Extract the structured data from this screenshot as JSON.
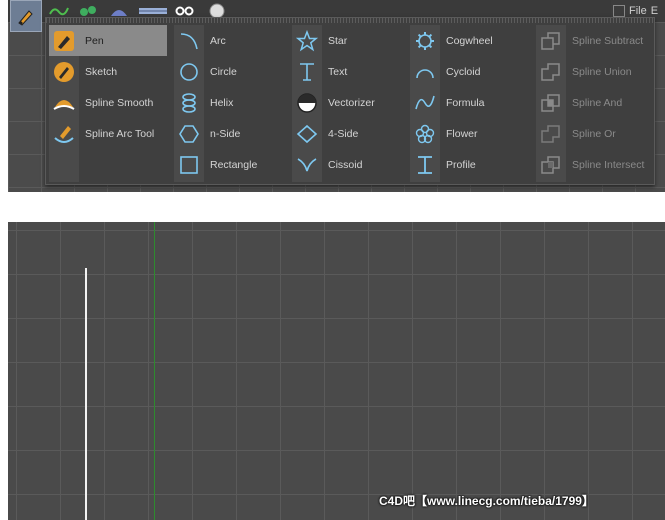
{
  "menubar": {
    "file_label": "File",
    "next_label": "E"
  },
  "menu": {
    "columns": [
      {
        "items": [
          {
            "label": "Pen",
            "icon": "pen-icon",
            "selected": true
          },
          {
            "label": "Sketch",
            "icon": "sketch-icon"
          },
          {
            "label": "Spline Smooth",
            "icon": "spline-smooth-icon"
          },
          {
            "label": "Spline Arc Tool",
            "icon": "spline-arc-tool-icon"
          }
        ]
      },
      {
        "items": [
          {
            "label": "Arc",
            "icon": "arc-icon"
          },
          {
            "label": "Circle",
            "icon": "circle-icon"
          },
          {
            "label": "Helix",
            "icon": "helix-icon"
          },
          {
            "label": "n-Side",
            "icon": "n-side-icon"
          },
          {
            "label": "Rectangle",
            "icon": "rectangle-icon"
          }
        ]
      },
      {
        "items": [
          {
            "label": "Star",
            "icon": "star-icon"
          },
          {
            "label": "Text",
            "icon": "text-icon"
          },
          {
            "label": "Vectorizer",
            "icon": "vectorizer-icon"
          },
          {
            "label": "4-Side",
            "icon": "four-side-icon"
          },
          {
            "label": "Cissoid",
            "icon": "cissoid-icon"
          }
        ]
      },
      {
        "items": [
          {
            "label": "Cogwheel",
            "icon": "cogwheel-icon"
          },
          {
            "label": "Cycloid",
            "icon": "cycloid-icon"
          },
          {
            "label": "Formula",
            "icon": "formula-icon"
          },
          {
            "label": "Flower",
            "icon": "flower-icon"
          },
          {
            "label": "Profile",
            "icon": "profile-icon"
          }
        ]
      },
      {
        "items": [
          {
            "label": "Spline Subtract",
            "icon": "spline-subtract-icon",
            "disabled": true
          },
          {
            "label": "Spline Union",
            "icon": "spline-union-icon",
            "disabled": true
          },
          {
            "label": "Spline And",
            "icon": "spline-and-icon",
            "disabled": true
          },
          {
            "label": "Spline Or",
            "icon": "spline-or-icon",
            "disabled": true
          },
          {
            "label": "Spline Intersect",
            "icon": "spline-intersect-icon",
            "disabled": true
          }
        ]
      }
    ]
  },
  "watermark": "C4D吧【www.linecg.com/tieba/1799】",
  "colors": {
    "accent_blue": "#7ec8f0",
    "pen_orange": "#e39b2c",
    "axis_green": "#2e8b2e"
  }
}
